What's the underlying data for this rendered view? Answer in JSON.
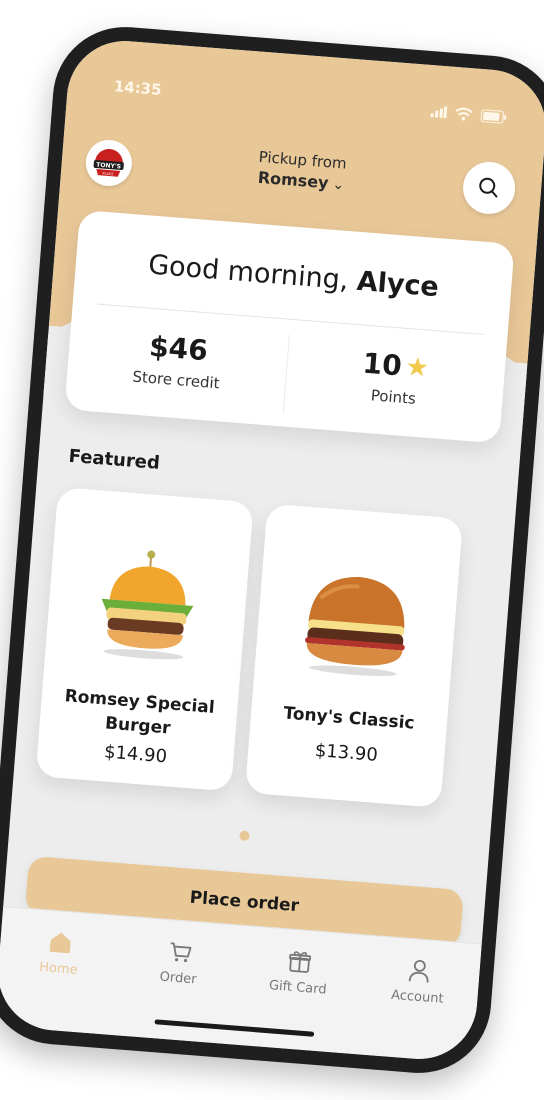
{
  "status_bar": {
    "time": "14:35"
  },
  "header": {
    "logo_text": "TONY'S",
    "logo_sub": "PLACE",
    "pickup_label": "Pickup from",
    "pickup_location": "Romsey",
    "pickup_chevron": "⌄"
  },
  "greeting": {
    "prefix": "Good morning,",
    "name": "Alyce"
  },
  "stats": {
    "credit_value": "$46",
    "credit_label": "Store credit",
    "points_value": "10",
    "points_star": "★",
    "points_label": "Points"
  },
  "featured": {
    "title": "Featured",
    "products": [
      {
        "name": "Romsey Special Burger",
        "price": "$14.90"
      },
      {
        "name": "Tony's Classic",
        "price": "$13.90"
      }
    ]
  },
  "cta": {
    "label": "Place order"
  },
  "nav": {
    "items": [
      {
        "label": "Home"
      },
      {
        "label": "Order"
      },
      {
        "label": "Gift Card"
      },
      {
        "label": "Account"
      }
    ]
  },
  "colors": {
    "accent": "#e9c898",
    "background": "#ededed",
    "text": "#1a1a1a",
    "star": "#f2c94c",
    "phone_frame": "#1f1f1f"
  }
}
